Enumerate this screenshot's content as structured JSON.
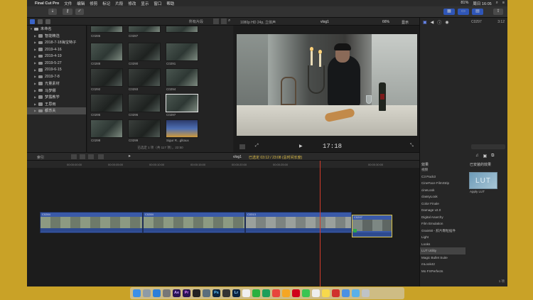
{
  "menubar": {
    "app": "Final Cut Pro",
    "items": [
      "文件",
      "编辑",
      "修剪",
      "标记",
      "片段",
      "修改",
      "显示",
      "窗口",
      "帮助"
    ],
    "battery": "81%",
    "clock": "周日 16:05"
  },
  "libraries": {
    "root": "未命名",
    "items": [
      "智能精选",
      "2018-7-18海宝特子",
      "2019-4-16",
      "2019-4-19",
      "2019-5-27",
      "2019-6-15",
      "2019-7-8",
      "光量素材",
      "马梦娜",
      "梦露教学",
      "王思雨",
      "都苏夫"
    ]
  },
  "browser": {
    "filter": "所有片段",
    "clips": [
      "C0286",
      "C0287",
      "C0288",
      "C0289",
      "C0290",
      "C0291",
      "C0292",
      "C0293",
      "C0294",
      "C0295",
      "C0296",
      "C0297",
      "C0298",
      "C0299",
      "Sigur R...glitaux"
    ],
    "status": "已选定 1 项（共 117 项），22:50"
  },
  "viewer": {
    "format": "1080p HD 24p, 立体声",
    "project": "vlog1",
    "zoom": "66%",
    "display": "显示",
    "timecode": "17:18"
  },
  "inspector": {
    "clip": "C0297",
    "duration": "3:12"
  },
  "timeline": {
    "index": "索引",
    "project": "vlog1",
    "selection": "已选定 03:12 / 23:08 (总时间长度)",
    "ruler": [
      "00:00:00:00",
      "00:00:05:00",
      "00:00:10:00",
      "00:00:15:00",
      "00:00:20:00",
      "00:00:25:00",
      "00:00:30:00"
    ],
    "clips": [
      {
        "label": "C0284"
      },
      {
        "label": "C0284"
      },
      {
        "label": "C0313"
      },
      {
        "label": "C0297"
      }
    ]
  },
  "effects": {
    "header": "效果",
    "installed": "已安装的效果",
    "categories": [
      "视频",
      "C3 Pack3",
      "CineFace FilmStrip",
      "cineLook",
      "classyLook",
      "Color Finale",
      "Damage v2.0",
      "Digital Anarchy",
      "Film Emulation",
      "Grain50 - 胶片颗粒插件",
      "Light",
      "Looks",
      "LUT Utility",
      "Magic Bullet Suite",
      "mLook42",
      "Mo FXPerfects"
    ],
    "selected": "LUT Utility",
    "tile_text": "LUT",
    "tile_label": "Apply LUT",
    "count": "1 项"
  },
  "dock_apps": [
    "Finder",
    "Launchpad",
    "Safari",
    "System Preferences",
    "After Effects",
    "Premiere",
    "Final Cut",
    "DaVinci",
    "Photoshop",
    "Stocks",
    "Lightroom",
    "QQ",
    "WeChat",
    "Sheets",
    "Music",
    "Weibo",
    "NetEase",
    "Messages",
    "Photos",
    "Notes",
    "PDF",
    "Charts",
    "Files",
    "Trash"
  ],
  "colors": {
    "accent": "#2f56b8",
    "playhead": "#d23b2b",
    "desktop": "#c9a227"
  }
}
